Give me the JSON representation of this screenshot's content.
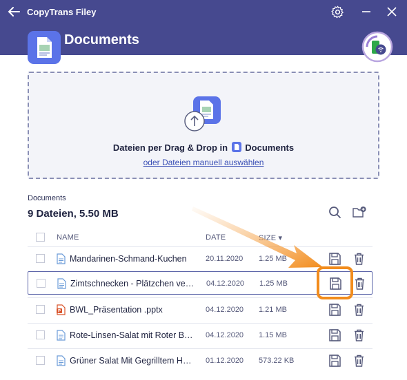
{
  "app": {
    "title": "CopyTrans Filey"
  },
  "category": {
    "title": "Documents"
  },
  "dropzone": {
    "text_prefix": "Dateien per Drag & Drop in",
    "target": "Documents",
    "link": "oder Dateien manuell auswählen"
  },
  "list": {
    "section_label": "Documents",
    "summary": "9 Dateien, 5.50 MB",
    "columns": {
      "name": "NAME",
      "date": "DATE",
      "size": "SIZE ▾"
    },
    "rows": [
      {
        "name": "Mandarinen-Schmand-Kuchen",
        "date": "20.11.2020",
        "size": "1.25 MB",
        "type": "doc-icon"
      },
      {
        "name": "Zimtschnecken - Plätzchen vegan",
        "date": "04.12.2020",
        "size": "1.25 MB",
        "type": "doc-icon"
      },
      {
        "name": "BWL_Präsentation .pptx",
        "date": "04.12.2020",
        "size": "1.21 MB",
        "type": "pptx-icon"
      },
      {
        "name": "Rote-Linsen-Salat mit Roter Bete",
        "date": "04.12.2020",
        "size": "1.15 MB",
        "type": "doc-icon"
      },
      {
        "name": "Grüner Salat Mit Gegrilltem Halloumi",
        "date": "01.12.2020",
        "size": "573.22 KB",
        "type": "doc-icon"
      }
    ]
  },
  "colors": {
    "header": "#46498f",
    "accent": "#3a4fb5",
    "highlight": "#f28c1c",
    "icon_gray": "#55597a"
  }
}
